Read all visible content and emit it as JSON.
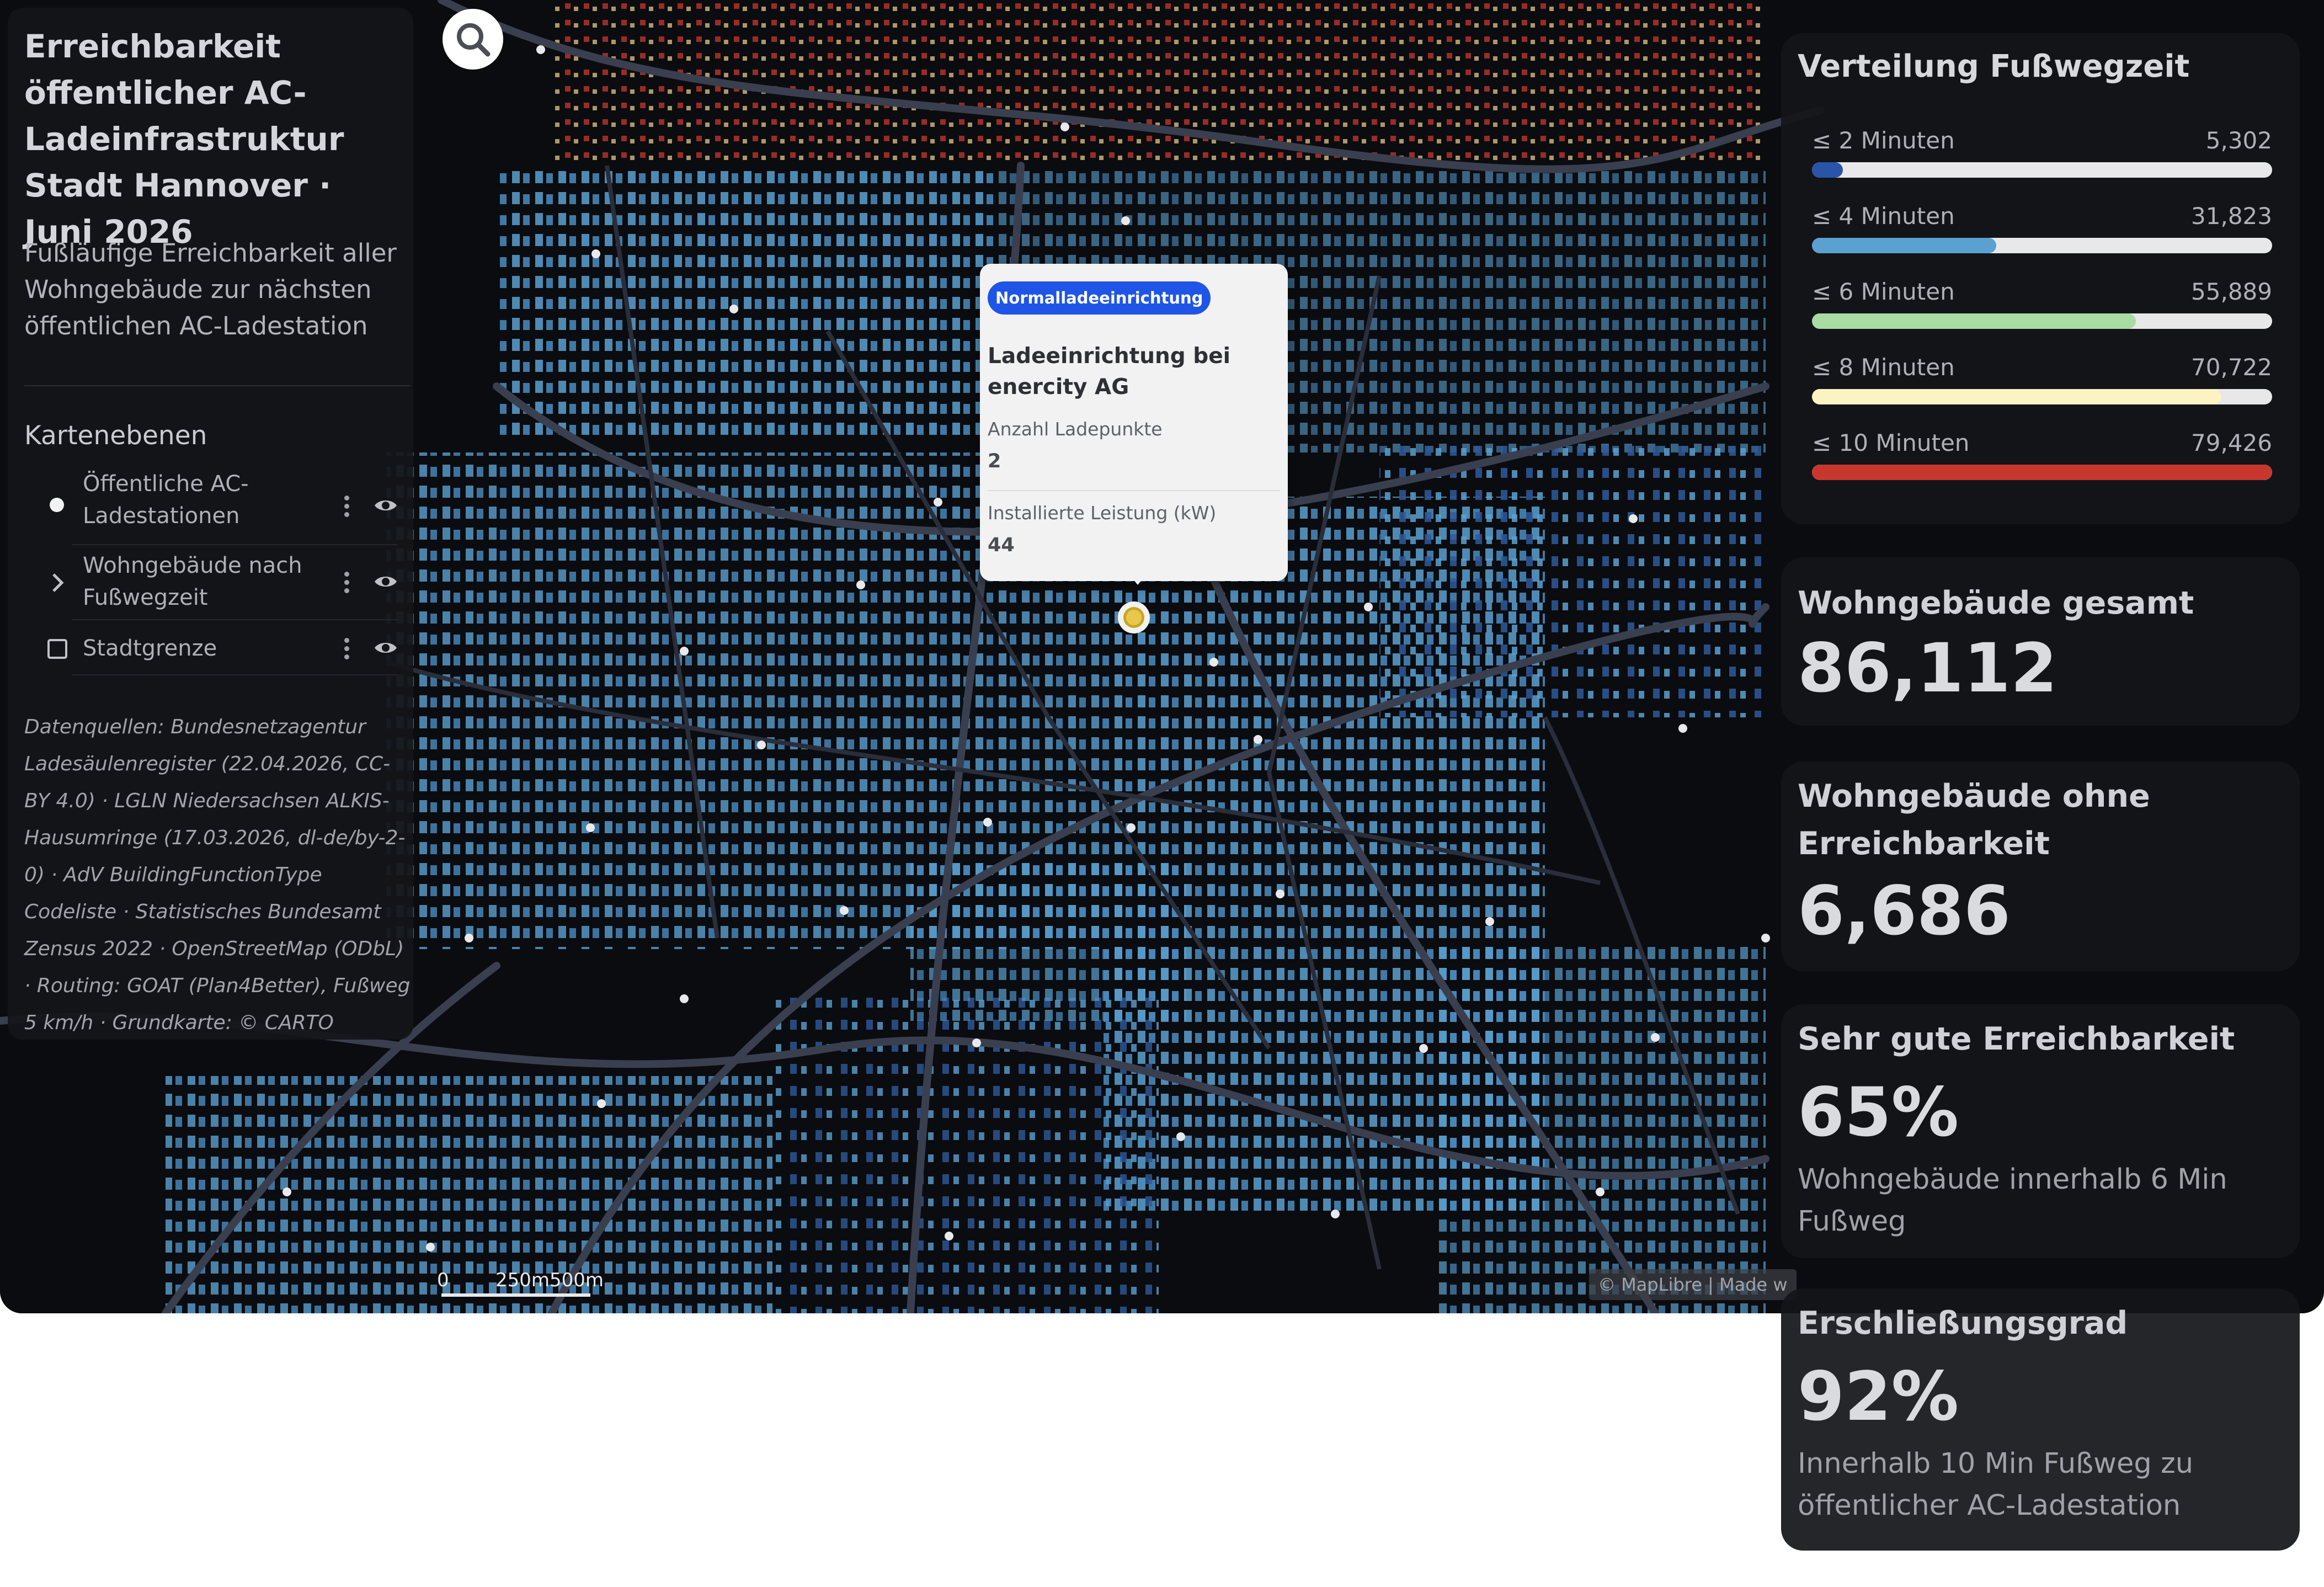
{
  "map": {
    "search_icon": "search-icon",
    "scale": {
      "zero": "0",
      "label": "250m500m"
    },
    "attribution": "© MapLibre | Made w"
  },
  "left_panel": {
    "title": "Erreichbarkeit öffentlicher AC-Ladeinfrastruktur Stadt Hannover · Juni 2026",
    "subtitle": "Fußläufige Erreichbarkeit aller Wohngebäude zur nächsten öffentlichen AC-Ladestation",
    "layers_heading": "Kartenebenen",
    "layers": [
      {
        "label": "Öffentliche AC-Ladestationen",
        "control": "dot-icon"
      },
      {
        "label": "Wohngebäude nach Fußwegzeit",
        "control": "chevron-right-icon"
      },
      {
        "label": "Stadtgrenze",
        "control": "checkbox-icon"
      }
    ],
    "sources": "Datenquellen: Bundesnetzagentur Ladesäulenregister (22.04.2026, CC-BY 4.0) · LGLN Niedersachsen ALKIS-Hausumringe (17.03.2026, dl-de/by-2-0) · AdV BuildingFunctionType Codeliste · Statistisches Bundesamt Zensus 2022 · OpenStreetMap (ODbL) · Routing: GOAT (Plan4Better), Fußweg 5 km/h · Grundkarte: © CARTO"
  },
  "popup": {
    "badge": "Normalladeeinrichtung",
    "title": "Ladeeinrichtung bei enercity AG",
    "fields": [
      {
        "label": "Anzahl Ladepunkte",
        "value": "2"
      },
      {
        "label": "Installierte Leistung (kW)",
        "value": "44"
      }
    ]
  },
  "distribution": {
    "title": "Verteilung Fußwegzeit",
    "rows": [
      {
        "label": "≤ 2 Minuten",
        "value": "5,302",
        "fraction": 0.067,
        "color": "#2a54a8"
      },
      {
        "label": "≤ 4 Minuten",
        "value": "31,823",
        "fraction": 0.401,
        "color": "#5aa0d0"
      },
      {
        "label": "≤ 6 Minuten",
        "value": "55,889",
        "fraction": 0.704,
        "color": "#a8dca2"
      },
      {
        "label": "≤ 8 Minuten",
        "value": "70,722",
        "fraction": 0.89,
        "color": "#fbf3c2"
      },
      {
        "label": "≤ 10 Minuten",
        "value": "79,426",
        "fraction": 1.0,
        "color": "#c8372d"
      }
    ]
  },
  "kpis": {
    "total": {
      "title": "Wohngebäude gesamt",
      "value": "86,112"
    },
    "no_access": {
      "title": "Wohngebäude ohne Erreichbarkeit",
      "value": "6,686"
    },
    "very_good": {
      "title": "Sehr gute Erreichbarkeit",
      "value": "65%",
      "sub": "Wohngebäude innerhalb 6 Min Fußweg"
    },
    "coverage": {
      "title": "Erschließungsgrad",
      "value": "92%",
      "sub": "Innerhalb 10 Min Fußweg zu öffentlicher AC-Ladestation"
    }
  },
  "colors": {
    "map_bg": "#0b0c0f",
    "road": "#3a3f4f",
    "building_blue": "#5aa0d0",
    "building_red": "#c8372d",
    "badge": "#1f55e6",
    "panel_bg": "#141519"
  }
}
